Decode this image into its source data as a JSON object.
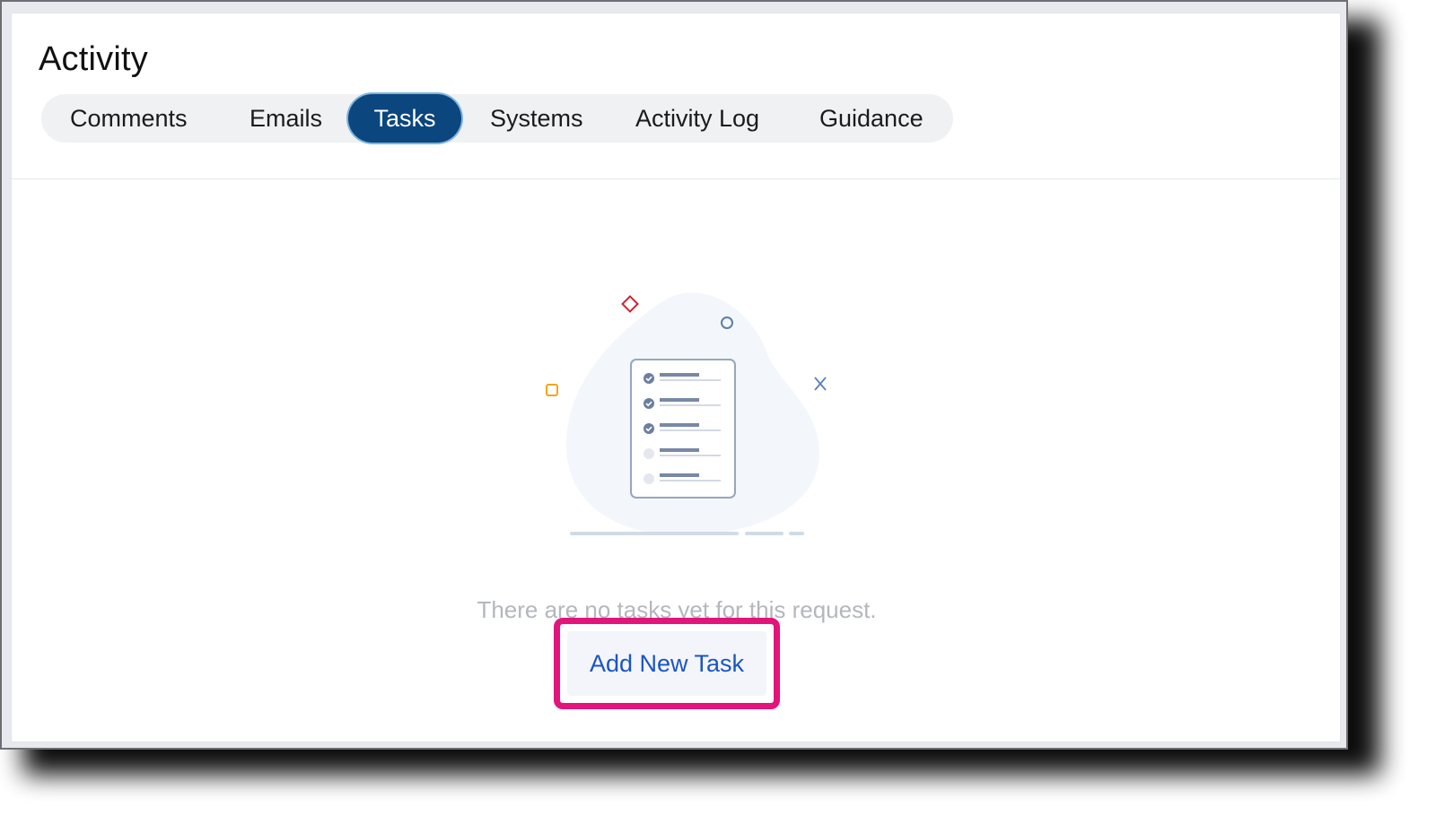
{
  "header": {
    "title": "Activity"
  },
  "tabs": [
    {
      "label": "Comments",
      "active": false
    },
    {
      "label": "Emails",
      "active": false
    },
    {
      "label": "Tasks",
      "active": true
    },
    {
      "label": "Systems",
      "active": false
    },
    {
      "label": "Activity Log",
      "active": false
    },
    {
      "label": "Guidance",
      "active": false
    }
  ],
  "empty_state": {
    "message": "There are no tasks yet for this request.",
    "button_label": "Add New Task",
    "illustration": "checklist-illustration"
  },
  "colors": {
    "active_tab": "#0b467e",
    "button_text": "#1a55c5",
    "highlight": "#e3147a"
  }
}
